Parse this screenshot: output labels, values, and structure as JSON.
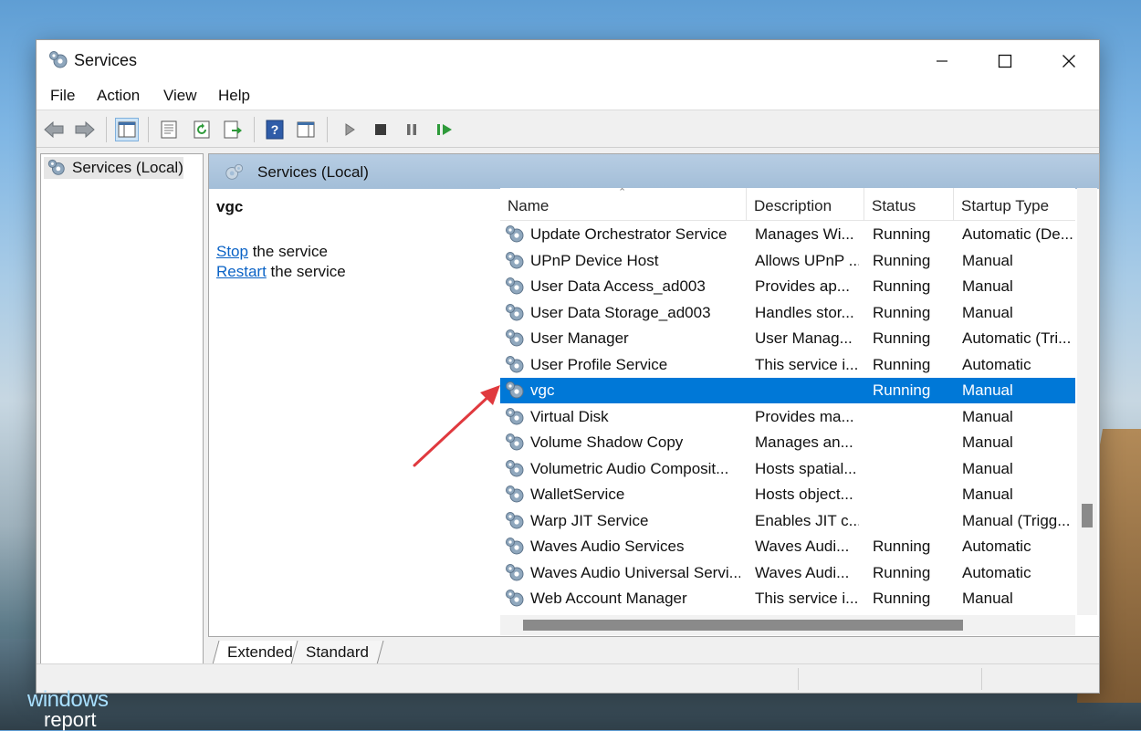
{
  "window": {
    "title": "Services",
    "controls": [
      "minimize-icon",
      "maximize-icon",
      "close-icon"
    ]
  },
  "menu": {
    "items": [
      "File",
      "Action",
      "View",
      "Help"
    ]
  },
  "toolbar": {
    "icons": [
      "back-arrow-icon",
      "forward-arrow-icon",
      "show-hide-console-tree-icon",
      "properties-icon",
      "refresh-icon",
      "export-list-icon",
      "help-icon",
      "show-hide-action-pane-icon",
      "start-service-icon",
      "stop-service-icon",
      "pause-service-icon",
      "resume-service-icon"
    ]
  },
  "tree": {
    "root_label": "Services (Local)"
  },
  "pane": {
    "header_title": "Services (Local)",
    "selected_service": "vgc",
    "actions": [
      {
        "link": "Stop",
        "rest": " the service"
      },
      {
        "link": "Restart",
        "rest": " the service"
      }
    ]
  },
  "list": {
    "columns": [
      "Name",
      "Description",
      "Status",
      "Startup Type"
    ],
    "selected_index": 6,
    "rows": [
      {
        "name": "Update Orchestrator Service",
        "description": "Manages Wi...",
        "status": "Running",
        "startup": "Automatic (De..."
      },
      {
        "name": "UPnP Device Host",
        "description": "Allows UPnP ...",
        "status": "Running",
        "startup": "Manual"
      },
      {
        "name": "User Data Access_ad003",
        "description": "Provides ap...",
        "status": "Running",
        "startup": "Manual"
      },
      {
        "name": "User Data Storage_ad003",
        "description": "Handles stor...",
        "status": "Running",
        "startup": "Manual"
      },
      {
        "name": "User Manager",
        "description": "User Manag...",
        "status": "Running",
        "startup": "Automatic (Tri..."
      },
      {
        "name": "User Profile Service",
        "description": "This service i...",
        "status": "Running",
        "startup": "Automatic"
      },
      {
        "name": "vgc",
        "description": "",
        "status": "Running",
        "startup": "Manual"
      },
      {
        "name": "Virtual Disk",
        "description": "Provides ma...",
        "status": "",
        "startup": "Manual"
      },
      {
        "name": "Volume Shadow Copy",
        "description": "Manages an...",
        "status": "",
        "startup": "Manual"
      },
      {
        "name": "Volumetric Audio Composit...",
        "description": "Hosts spatial...",
        "status": "",
        "startup": "Manual"
      },
      {
        "name": "WalletService",
        "description": "Hosts object...",
        "status": "",
        "startup": "Manual"
      },
      {
        "name": "Warp JIT Service",
        "description": "Enables JIT c...",
        "status": "",
        "startup": "Manual (Trigg..."
      },
      {
        "name": "Waves Audio Services",
        "description": "Waves Audi...",
        "status": "Running",
        "startup": "Automatic"
      },
      {
        "name": "Waves Audio Universal Servi...",
        "description": "Waves Audi...",
        "status": "Running",
        "startup": "Automatic"
      },
      {
        "name": "Web Account Manager",
        "description": "This service i...",
        "status": "Running",
        "startup": "Manual"
      }
    ]
  },
  "tabs": [
    "Extended",
    "Standard"
  ],
  "active_tab": "Extended",
  "watermark": {
    "line1": "windows",
    "line2": "report"
  },
  "colors": {
    "selection": "#0078d7",
    "link": "#0b63c6",
    "pane_header": "#a3bed8",
    "annotation_arrow": "#e0393e"
  }
}
